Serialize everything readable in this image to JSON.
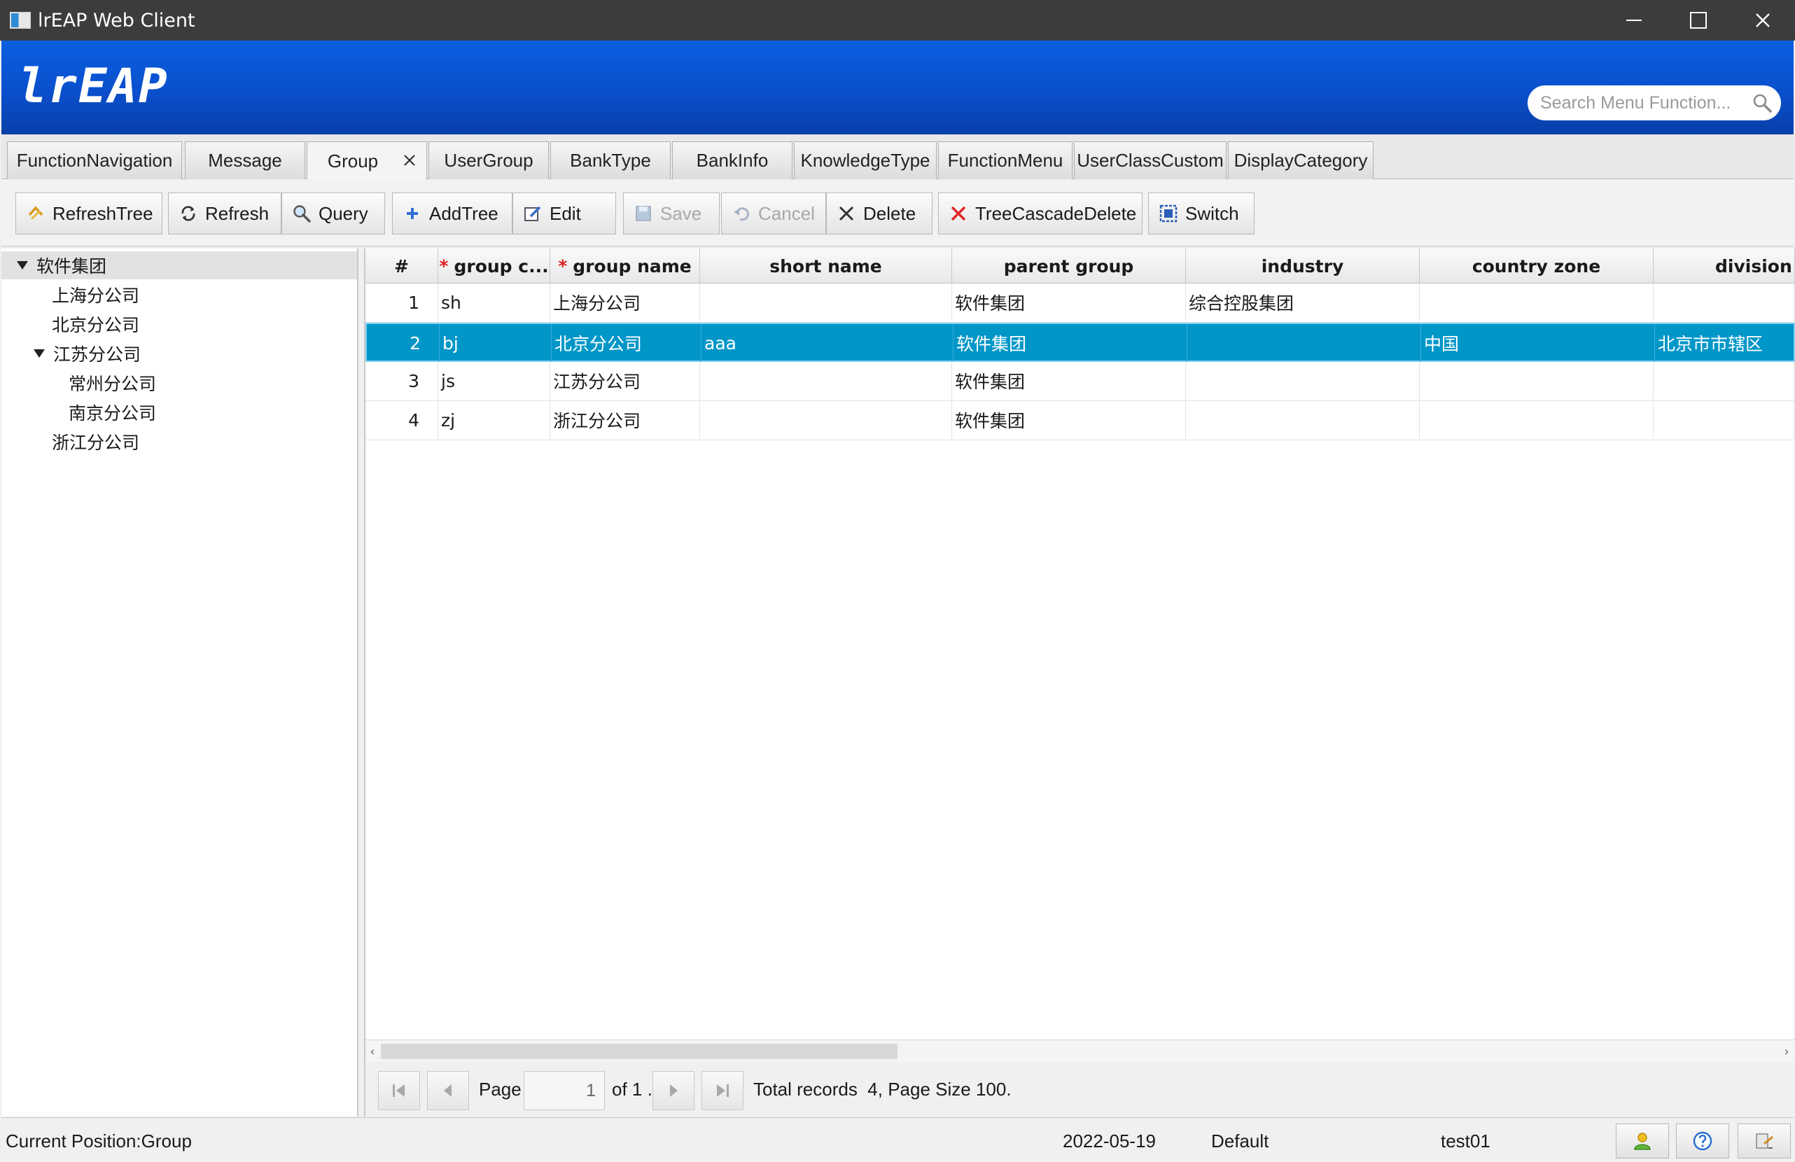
{
  "window": {
    "title": "lrEAP Web Client"
  },
  "banner": {
    "logo": "lrEAP",
    "search_placeholder": "Search Menu Function..."
  },
  "tabs": [
    {
      "label": "FunctionNavigation"
    },
    {
      "label": "Message"
    },
    {
      "label": "Group",
      "active": true,
      "closable": true
    },
    {
      "label": "UserGroup"
    },
    {
      "label": "BankType"
    },
    {
      "label": "BankInfo"
    },
    {
      "label": "KnowledgeType"
    },
    {
      "label": "FunctionMenu"
    },
    {
      "label": "UserClassCustom"
    },
    {
      "label": "DisplayCategory"
    }
  ],
  "toolbar": {
    "refresh_tree": "RefreshTree",
    "refresh": "Refresh",
    "query": "Query",
    "add_tree": "AddTree",
    "edit": "Edit",
    "save": "Save",
    "cancel": "Cancel",
    "delete": "Delete",
    "tree_cascade_delete": "TreeCascadeDelete",
    "switch": "Switch"
  },
  "tree": {
    "root": "软件集团",
    "items": [
      "上海分公司",
      "北京分公司",
      "江苏分公司",
      "常州分公司",
      "南京分公司",
      "浙江分公司"
    ]
  },
  "grid": {
    "columns": [
      "#",
      "group c...",
      "group name",
      "short name",
      "parent group",
      "industry",
      "country zone",
      "division z"
    ],
    "rows": [
      {
        "num": "1",
        "code": "sh",
        "name": "上海分公司",
        "short": "",
        "parent": "软件集团",
        "industry": "综合控股集团",
        "country": "",
        "division": ""
      },
      {
        "num": "2",
        "code": "bj",
        "name": "北京分公司",
        "short": "aaa",
        "parent": "软件集团",
        "industry": "",
        "country": "中国",
        "division": "北京市市辖区"
      },
      {
        "num": "3",
        "code": "js",
        "name": "江苏分公司",
        "short": "",
        "parent": "软件集团",
        "industry": "",
        "country": "",
        "division": ""
      },
      {
        "num": "4",
        "code": "zj",
        "name": "浙江分公司",
        "short": "",
        "parent": "软件集团",
        "industry": "",
        "country": "",
        "division": ""
      }
    ],
    "selected_row": 2
  },
  "pager": {
    "page_label": "Page",
    "page_value": "1",
    "of_label": "of 1 .",
    "summary": "Total records  4, Page Size 100."
  },
  "status": {
    "position": "Current Position:Group",
    "date": "2022-05-19",
    "theme": "Default",
    "user": "test01"
  },
  "colors": {
    "banner": "#0a4fcc",
    "selected_row": "#0096c8"
  }
}
